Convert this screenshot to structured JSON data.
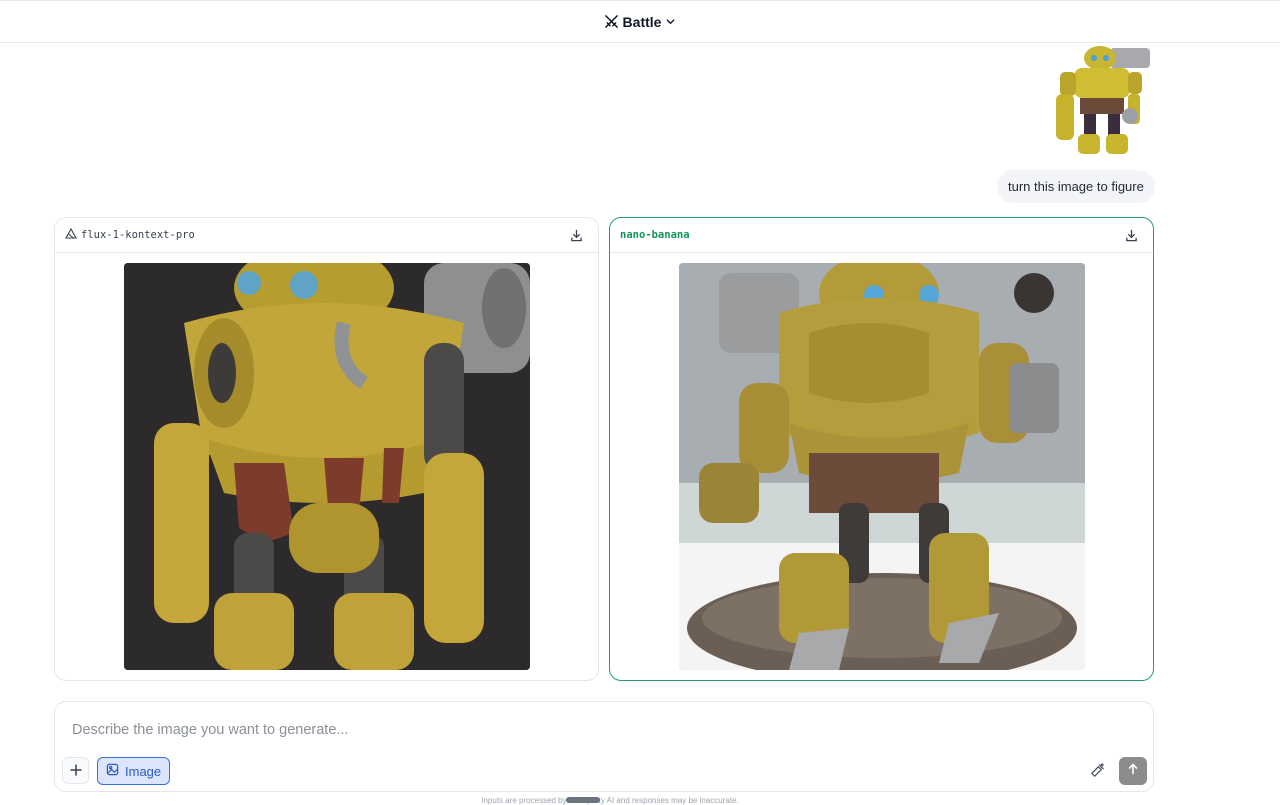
{
  "header": {
    "mode_label": "Battle"
  },
  "conversation": {
    "user_prompt": "turn this image to figure"
  },
  "results": [
    {
      "model": "flux-1-kontext-pro"
    },
    {
      "model": "nano-banana"
    }
  ],
  "composer": {
    "placeholder": "Describe the image you want to generate...",
    "image_toggle_label": "Image"
  },
  "footer": {
    "disclaimer": "Inputs are processed by third-party AI and responses may be inaccurate."
  },
  "colors": {
    "winner_border": "#22a06b",
    "toggle_active": "#3b6fd8",
    "send_disabled": "#8c8c8c"
  }
}
